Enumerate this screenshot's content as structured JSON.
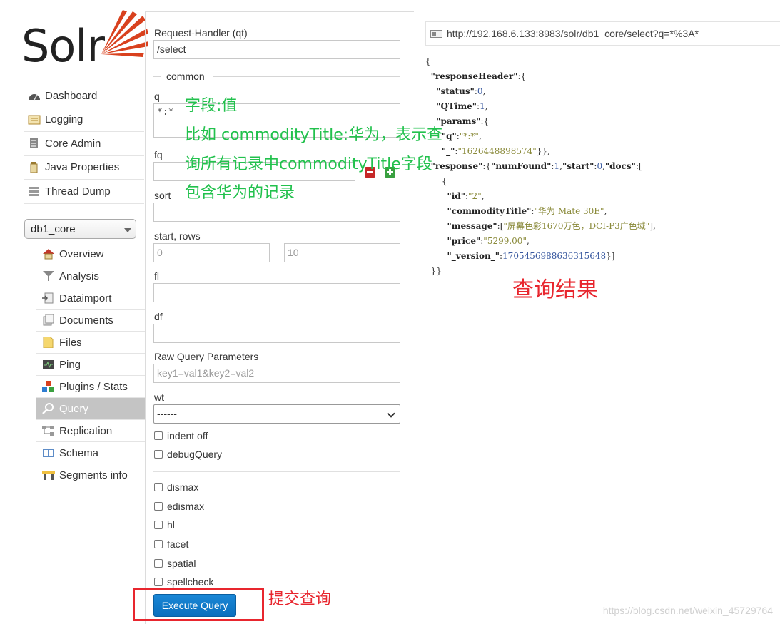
{
  "logo": {
    "text": "Solr",
    "accent": "#d9411e"
  },
  "main_nav": [
    {
      "label": "Dashboard",
      "icon": "dashboard-icon"
    },
    {
      "label": "Logging",
      "icon": "logging-icon"
    },
    {
      "label": "Core Admin",
      "icon": "core-admin-icon"
    },
    {
      "label": "Java Properties",
      "icon": "java-icon"
    },
    {
      "label": "Thread Dump",
      "icon": "thread-dump-icon"
    }
  ],
  "core_selector": {
    "value": "db1_core"
  },
  "core_nav": [
    {
      "label": "Overview",
      "icon": "overview-icon"
    },
    {
      "label": "Analysis",
      "icon": "analysis-icon"
    },
    {
      "label": "Dataimport",
      "icon": "dataimport-icon"
    },
    {
      "label": "Documents",
      "icon": "documents-icon"
    },
    {
      "label": "Files",
      "icon": "files-icon"
    },
    {
      "label": "Ping",
      "icon": "ping-icon"
    },
    {
      "label": "Plugins / Stats",
      "icon": "plugins-icon"
    },
    {
      "label": "Query",
      "icon": "query-icon",
      "active": true
    },
    {
      "label": "Replication",
      "icon": "replication-icon"
    },
    {
      "label": "Schema",
      "icon": "schema-icon"
    },
    {
      "label": "Segments info",
      "icon": "segments-icon"
    }
  ],
  "form": {
    "qt_label": "Request-Handler (qt)",
    "qt_value": "/select",
    "common_legend": "common",
    "q_label": "q",
    "q_value": "*:*",
    "fq_label": "fq",
    "fq_value": "",
    "sort_label": "sort",
    "start_rows_label": "start, rows",
    "start_placeholder": "0",
    "rows_placeholder": "10",
    "fl_label": "fl",
    "df_label": "df",
    "raw_label": "Raw Query Parameters",
    "raw_placeholder": "key1=val1&key2=val2",
    "wt_label": "wt",
    "wt_value": "------",
    "indent_label": "indent off",
    "debug_label": "debugQuery",
    "options": [
      "dismax",
      "edismax",
      "hl",
      "facet",
      "spatial",
      "spellcheck"
    ],
    "execute_label": "Execute Query"
  },
  "result": {
    "url": "http://192.168.6.133:8983/solr/db1_core/select?q=*%3A*",
    "json": {
      "status": "0",
      "qtime": "1",
      "q": "*:*",
      "underscore": "1626448898574",
      "numFound": "1",
      "start": "0",
      "id": "2",
      "commodityTitle": "华为 Mate 30E",
      "message": "屏幕色彩1670万色，DCI-P3广色域",
      "price": "5299.00",
      "version": "1705456988636315648"
    }
  },
  "annotations": {
    "green_1": "字段:值",
    "green_2": "比如 commodityTitle:华为，表示查",
    "green_3": "询所有记录中commodityTitle字段",
    "green_4": "包含华为的记录",
    "red_result": "查询结果",
    "red_submit": "提交查询"
  },
  "watermark": "https://blog.csdn.net/weixin_45729764"
}
